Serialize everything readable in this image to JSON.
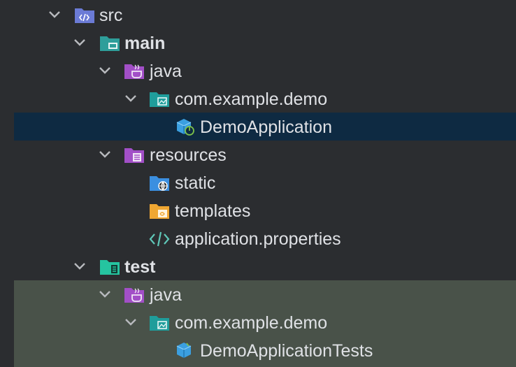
{
  "tree": {
    "items": [
      {
        "label": "src",
        "icon": "source-folder-icon",
        "expanded": true
      },
      {
        "label": "main",
        "icon": "module-folder-icon",
        "expanded": true
      },
      {
        "label": "java",
        "icon": "java-source-root-icon",
        "expanded": true
      },
      {
        "label": "com.example.demo",
        "icon": "package-icon",
        "expanded": true
      },
      {
        "label": "DemoApplication",
        "icon": "spring-boot-class-icon",
        "selected": true
      },
      {
        "label": "resources",
        "icon": "resources-root-icon",
        "expanded": true
      },
      {
        "label": "static",
        "icon": "web-folder-icon"
      },
      {
        "label": "templates",
        "icon": "templates-folder-icon"
      },
      {
        "label": "application.properties",
        "icon": "properties-file-icon"
      },
      {
        "label": "test",
        "icon": "test-module-folder-icon",
        "expanded": true
      },
      {
        "label": "java",
        "icon": "java-test-root-icon",
        "expanded": true
      },
      {
        "label": "com.example.demo",
        "icon": "package-icon",
        "expanded": true
      },
      {
        "label": "DemoApplicationTests",
        "icon": "test-class-icon"
      }
    ]
  },
  "colors": {
    "background": "#2b2d30",
    "selection": "#0e2a42",
    "test_highlight": "#495249",
    "text": "#dfe1e5"
  }
}
